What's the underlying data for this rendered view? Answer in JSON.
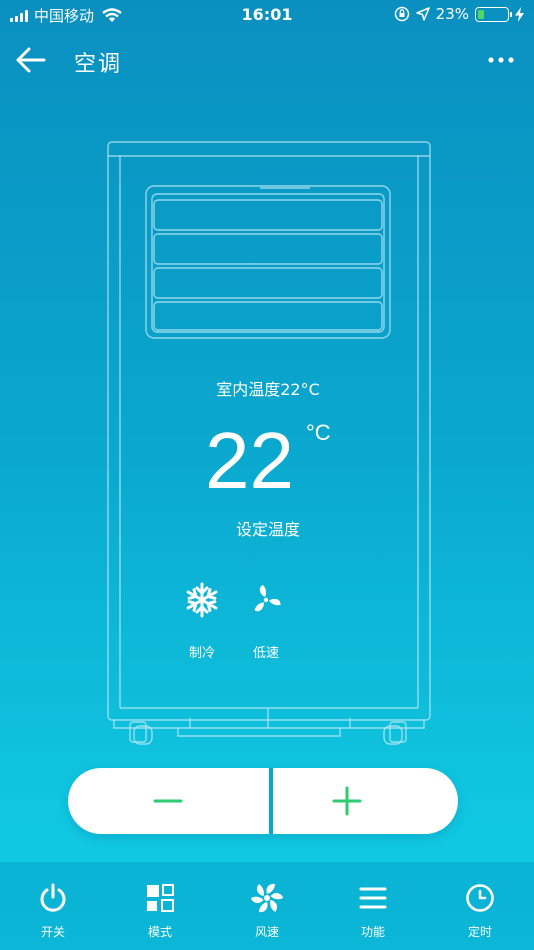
{
  "status_bar": {
    "carrier": "中国移动",
    "time": "16:01",
    "battery": "23%",
    "battery_level": 0.23,
    "icons": [
      "signal-icon",
      "wifi-icon",
      "orientation-lock-icon",
      "location-icon",
      "battery-icon",
      "charging-icon"
    ]
  },
  "nav": {
    "title": "空调",
    "back_icon": "arrow-left-icon",
    "more_icon": "more-dots-icon"
  },
  "display": {
    "indoor_temp": "室内温度22°C",
    "set_temperature": "22",
    "unit": "°C",
    "set_label": "设定温度",
    "mode_label": "制冷",
    "mode_icon": "snowflake-icon",
    "fan_label": "低速",
    "fan_icon": "fan-icon"
  },
  "stepper": {
    "decrease_icon": "minus-icon",
    "increase_icon": "plus-icon",
    "icon_color": "#2dcc70"
  },
  "tabs": [
    {
      "label": "开关",
      "icon": "power-icon"
    },
    {
      "label": "模式",
      "icon": "mode-grid-icon"
    },
    {
      "label": "风速",
      "icon": "fan-speed-icon"
    },
    {
      "label": "功能",
      "icon": "menu-icon"
    },
    {
      "label": "定时",
      "icon": "clock-icon"
    }
  ]
}
